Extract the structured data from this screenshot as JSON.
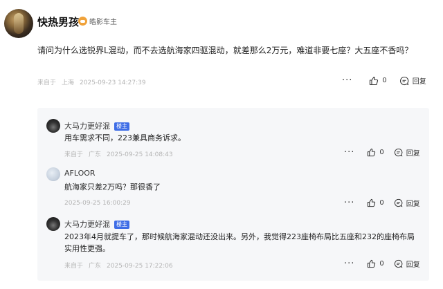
{
  "post": {
    "author": "快热男孩",
    "badge_label": "皓影车主",
    "content": "请问为什么选锐界L混动，而不去选航海家四驱混动，就差那么2万元，难道非要七座？大五座不香吗？",
    "meta": {
      "prefix": "来自于",
      "location": "上海",
      "time": "2025-09-23 14:27:39"
    },
    "more": "···",
    "likes": "0",
    "reply_label": "回复"
  },
  "comments": [
    {
      "author": "大马力更好混",
      "host_badge": "楼主",
      "content": "用车需求不同，223兼具商务诉求。",
      "meta": {
        "prefix": "来自于",
        "location": "广东",
        "time": "2025-09-25 14:08:43"
      },
      "more": "···",
      "likes": "0",
      "reply_label": "回复"
    },
    {
      "author": "AFLOOR",
      "content": "航海家只差2万吗？那很香了",
      "meta": {
        "time": "2025-09-25 16:00:29"
      },
      "more": "···",
      "likes": "0",
      "reply_label": "回复"
    },
    {
      "author": "大马力更好混",
      "host_badge": "楼主",
      "content": "2023年4月就提车了，那时候航海家混动还没出来。另外，我觉得223座椅布局比五座和232的座椅布局实用性更强。",
      "meta": {
        "prefix": "来自于",
        "location": "广东",
        "time": "2025-09-25 17:22:06"
      },
      "more": "···",
      "likes": "0",
      "reply_label": "回复"
    }
  ],
  "icons": {
    "like": "thumbs-up-icon",
    "reply": "reply-bubble-icon",
    "more": "more-dots-icon"
  },
  "colors": {
    "host_badge": "#3e6de6",
    "owner_badge": "#f0a23a",
    "meta_text": "#b4b4b4",
    "comments_bg": "#f6f7f9"
  }
}
